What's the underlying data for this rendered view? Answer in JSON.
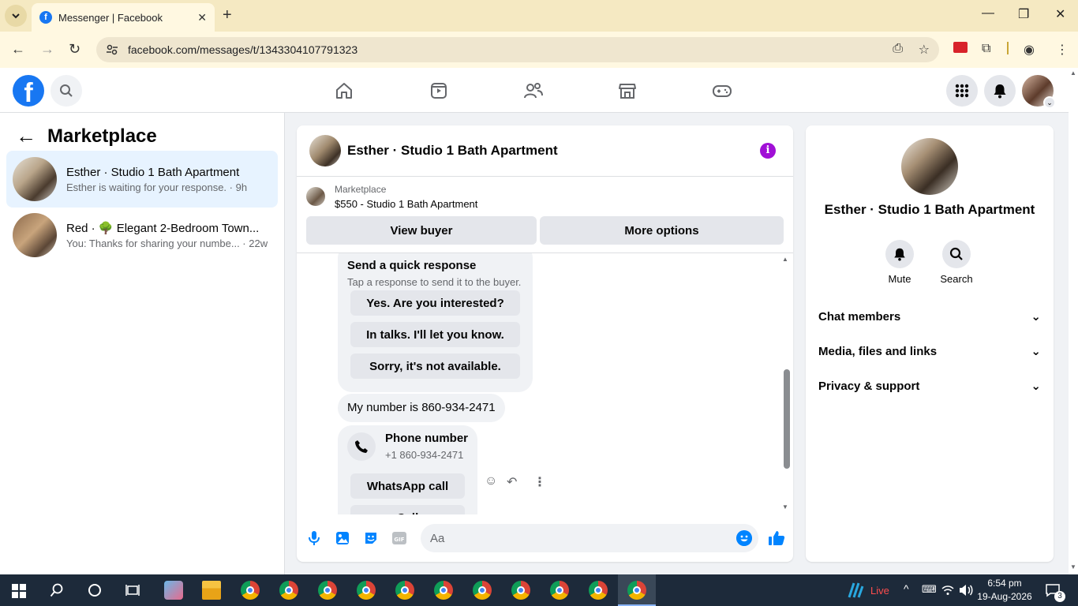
{
  "browser": {
    "tab_title": "Messenger | Facebook",
    "url": "facebook.com/messages/t/1343304107791323"
  },
  "sidebar": {
    "title": "Marketplace",
    "conversations": [
      {
        "name": "Esther · Studio 1 Bath Apartment",
        "snippet": "Esther is waiting for your response. · 9h"
      },
      {
        "name": "Red · 🌳 Elegant 2-Bedroom Town...",
        "snippet": "You: Thanks for sharing your numbe... · 22w"
      }
    ]
  },
  "chat": {
    "header_name": "Esther · Studio 1 Bath Apartment",
    "marketplace_label": "Marketplace",
    "listing": "$550 - Studio 1 Bath Apartment",
    "view_buyer": "View buyer",
    "more_options": "More options",
    "quick_response": {
      "title": "Send a quick response",
      "subtitle": "Tap a response to send it to the buyer.",
      "options": [
        "Yes. Are you interested?",
        "In talks. I'll let you know.",
        "Sorry, it's not available."
      ]
    },
    "message_number": "My number is 860-934-2471",
    "phone_card": {
      "title": "Phone number",
      "number": "+1 860-934-2471",
      "whatsapp": "WhatsApp call",
      "call": "Call"
    },
    "composer_placeholder": "Aa"
  },
  "info_panel": {
    "name": "Esther · Studio 1 Bath Apartment",
    "mute": "Mute",
    "search": "Search",
    "sections": [
      "Chat members",
      "Media, files and links",
      "Privacy & support"
    ]
  },
  "taskbar": {
    "live": "Live",
    "time": "6:54 pm",
    "date": "19-Aug-2026",
    "notifications": "3"
  },
  "colors": {
    "accent": "#1877f2",
    "active_conv": "#e7f3ff",
    "info_purple": "#a00fd6"
  }
}
